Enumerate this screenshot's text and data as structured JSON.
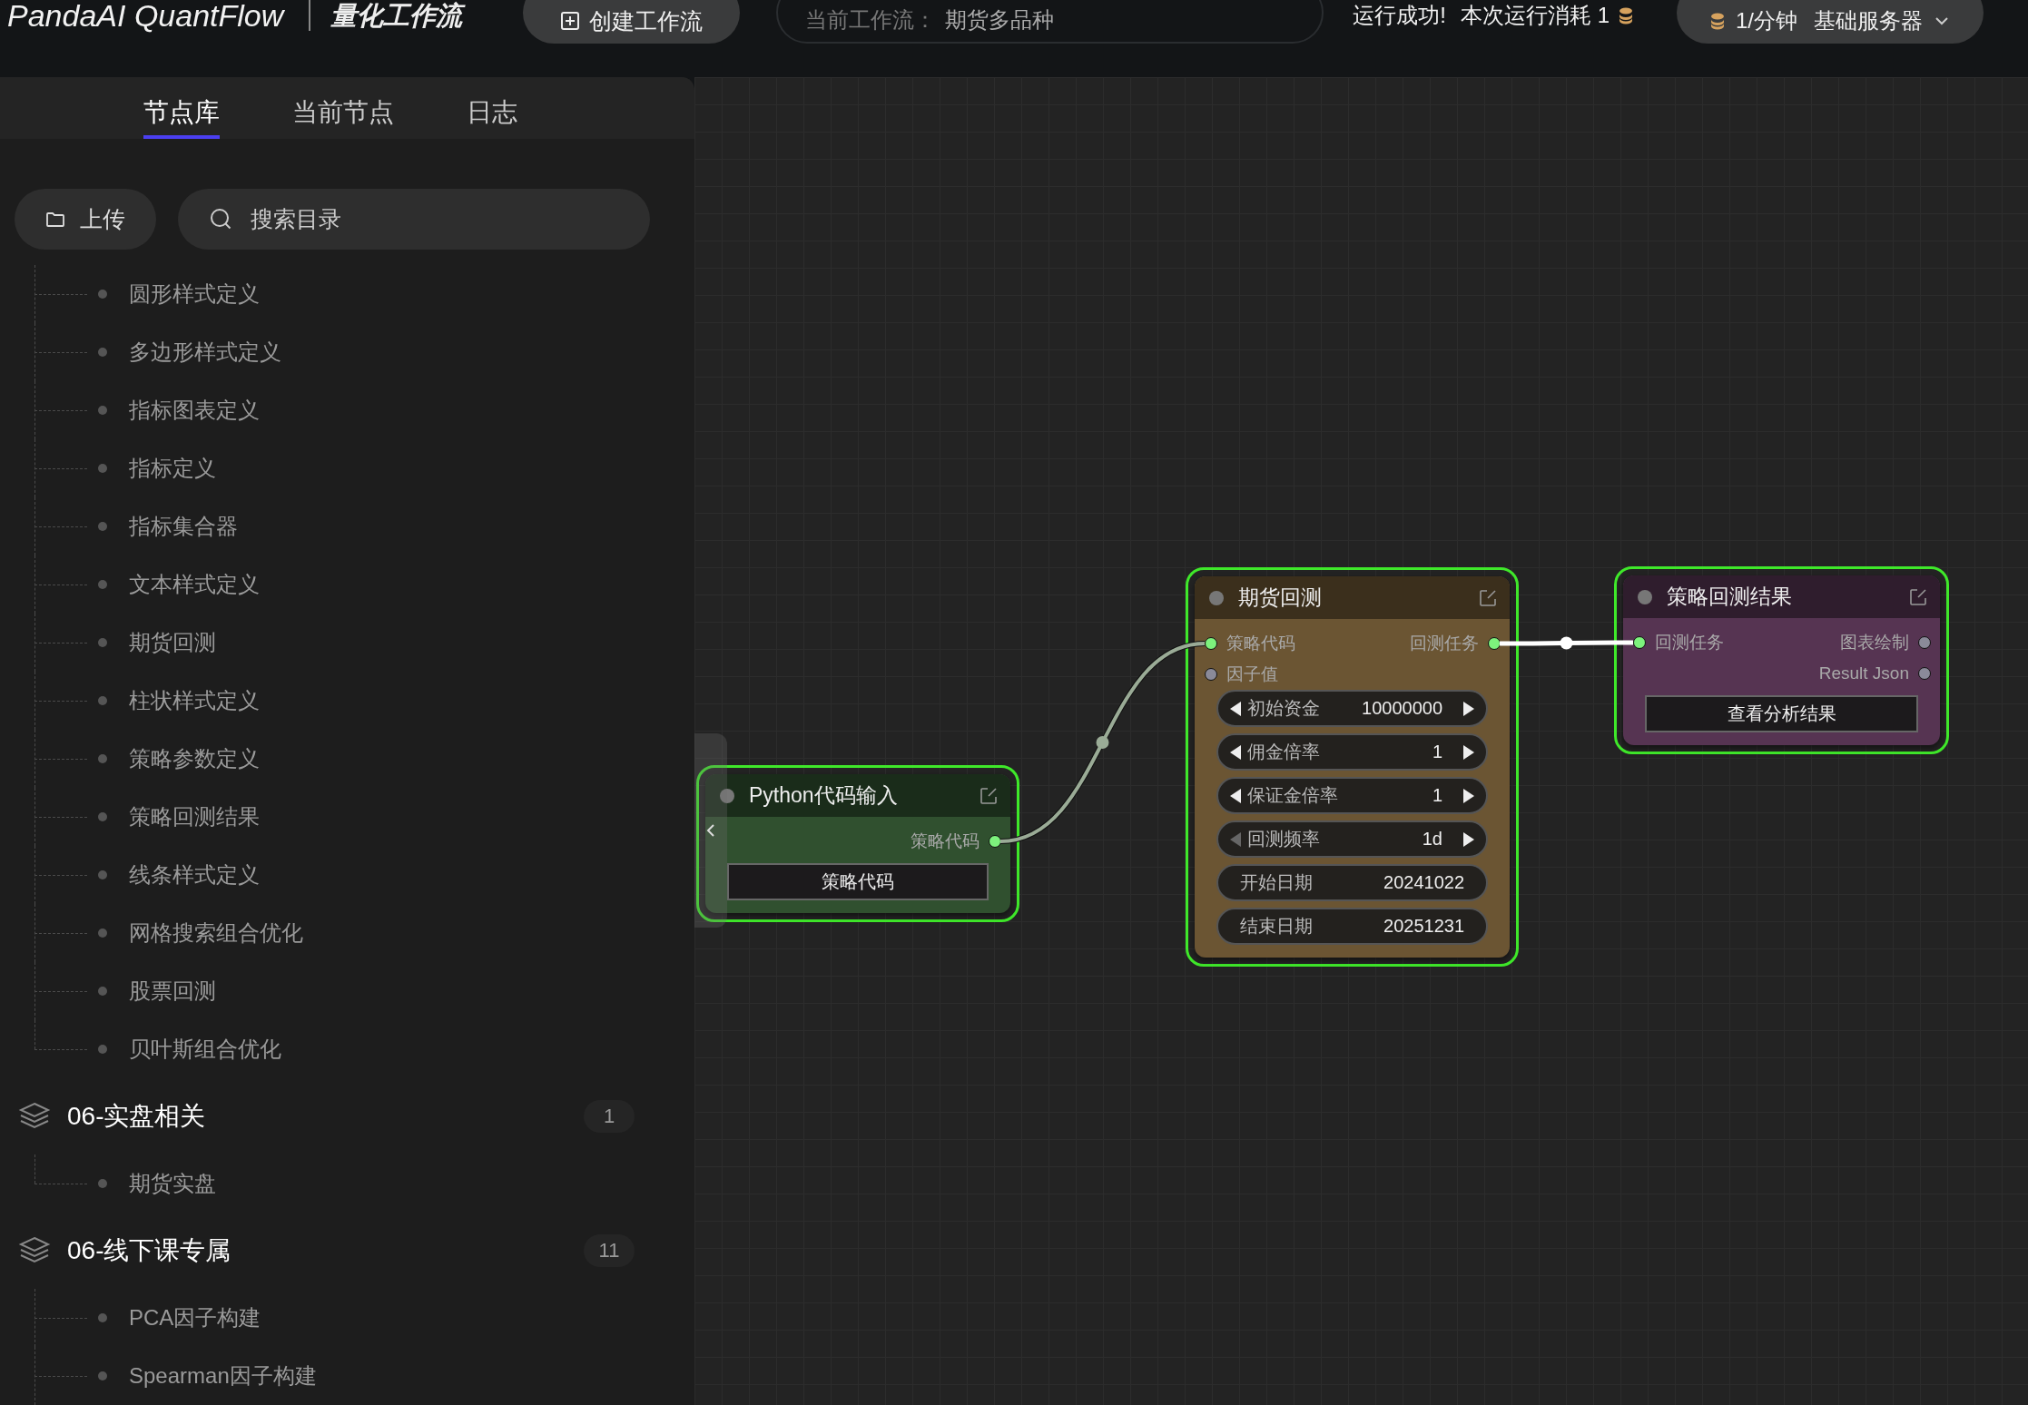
{
  "topbar": {
    "logo": "PandaAI QuantFlow",
    "title": "量化工作流",
    "create_button": "创建工作流",
    "current_workflow": {
      "label": "当前工作流：",
      "value": "期货多品种"
    },
    "status": {
      "message": "运行成功!",
      "cost": "本次运行消耗 1"
    },
    "server": {
      "rate": "1/分钟",
      "name": "基础服务器"
    }
  },
  "sidebar": {
    "tabs": [
      {
        "label": "节点库",
        "selected": true
      },
      {
        "label": "当前节点",
        "selected": false
      },
      {
        "label": "日志",
        "selected": false
      }
    ],
    "upload_button": "上传",
    "search": {
      "placeholder": "搜索目录"
    },
    "tree": [
      {
        "children": [
          "圆形样式定义",
          "多边形样式定义",
          "指标图表定义",
          "指标定义",
          "指标集合器",
          "文本样式定义",
          "期货回测",
          "柱状样式定义",
          "策略参数定义",
          "策略回测结果",
          "线条样式定义",
          "网格搜索组合优化",
          "股票回测",
          "贝叶斯组合优化"
        ]
      },
      {
        "title": "06-实盘相关",
        "count": "1",
        "children": [
          "期货实盘"
        ]
      },
      {
        "title": "06-线下课专属",
        "count": "11",
        "children": [
          "PCA因子构建",
          "Spearman因子构建"
        ]
      }
    ]
  },
  "canvas": {
    "nodes": [
      {
        "title": "Python代码输入",
        "color": "#30502f",
        "selected": true,
        "outputs": [
          {
            "label": "策略代码",
            "connected": true
          }
        ],
        "widgets": [
          {
            "kind": "button",
            "label": "策略代码"
          }
        ]
      },
      {
        "title": "期货回测",
        "color": "#6b5533",
        "selected": true,
        "inputs": [
          {
            "label": "策略代码",
            "connected": true
          },
          {
            "label": "因子值",
            "connected": false
          }
        ],
        "outputs": [
          {
            "label": "回测任务",
            "connected": true
          }
        ],
        "widgets": [
          {
            "kind": "stepper",
            "label": "初始资金",
            "value": "10000000",
            "prev_disabled": false
          },
          {
            "kind": "stepper",
            "label": "佣金倍率",
            "value": "1",
            "prev_disabled": false
          },
          {
            "kind": "stepper",
            "label": "保证金倍率",
            "value": "1",
            "prev_disabled": false
          },
          {
            "kind": "stepper",
            "label": "回测频率",
            "value": "1d",
            "prev_disabled": true
          },
          {
            "kind": "text",
            "label": "开始日期",
            "value": "20241022"
          },
          {
            "kind": "text",
            "label": "结束日期",
            "value": "20251231"
          }
        ]
      },
      {
        "title": "策略回测结果",
        "color": "#563452",
        "selected": true,
        "inputs": [
          {
            "label": "回测任务",
            "connected": true
          }
        ],
        "outputs": [
          {
            "label": "图表绘制",
            "connected": false
          },
          {
            "label": "Result Json",
            "connected": false
          }
        ],
        "widgets": [
          {
            "kind": "button",
            "label": "查看分析结果"
          }
        ]
      }
    ],
    "links": [
      {
        "selected": false
      },
      {
        "selected": true
      }
    ]
  }
}
